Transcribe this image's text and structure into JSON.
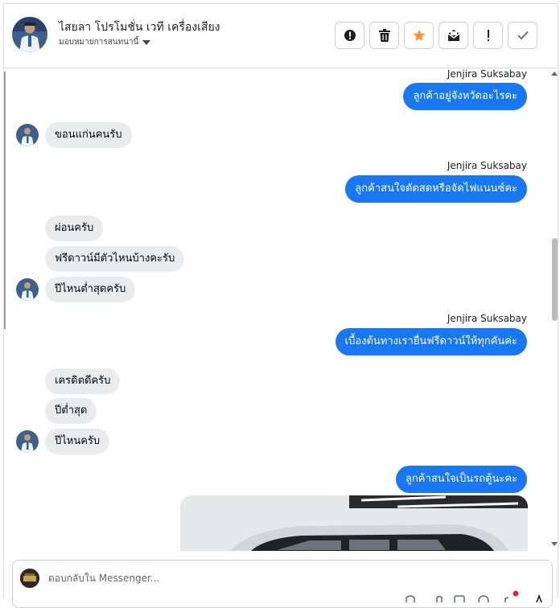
{
  "header": {
    "name": "ไสยลา โปรโมชั่น เวที เครื่องเสียง",
    "assign_label": "มอบหมายการสนทนานี้",
    "actions": [
      "important-icon",
      "trash-icon",
      "star-icon",
      "mark-unread-icon",
      "exclamation-icon",
      "check-icon"
    ]
  },
  "messages": {
    "m1": {
      "sender": "Jenjira Suksabay",
      "text": "ลูกค้าอยู่จังหวัดอะไรคะ"
    },
    "m2": {
      "text": "ขอนแก่นคนรับ"
    },
    "m3": {
      "sender": "Jenjira Suksabay",
      "text": "ลูกค้าสนใจตัดสดหรือจัดไฟแนนซ์คะ"
    },
    "m4": {
      "text": "ผ่อนครับ"
    },
    "m5": {
      "text": "ฟรีดาวน์มีตัวไหนบ้างคะรับ"
    },
    "m6": {
      "text": "ปีไหนต่ำสุดครับ"
    },
    "m7": {
      "sender": "Jenjira Suksabay",
      "text": "เบื้องต้นทางเรายื่นฟรีดาวน์ให้ทุกคันค่ะ"
    },
    "m8": {
      "text": "เครดิตดีครับ"
    },
    "m9": {
      "text": "ปีต่ำสุด"
    },
    "m10": {
      "text": "ปีไหนครับ"
    },
    "m11": {
      "text": "ลูกค้าสนใจเป็นรถตู้นะคะ"
    }
  },
  "composer": {
    "placeholder": "ตอบกลับใน Messenger..."
  },
  "colors": {
    "outgoing": "#1877f2",
    "incoming": "#e9ebee",
    "star": "#f7923a"
  }
}
